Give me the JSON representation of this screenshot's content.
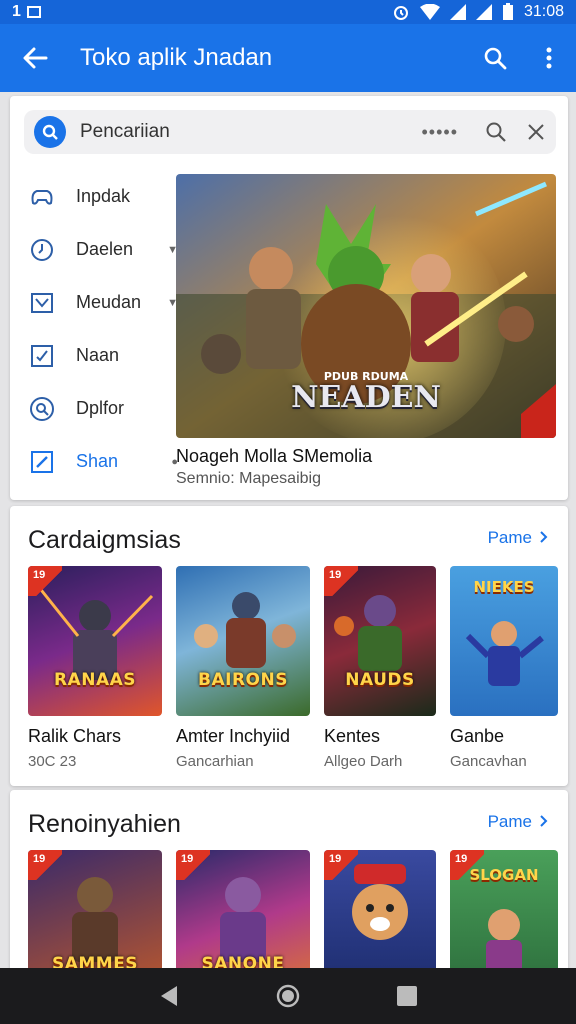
{
  "status": {
    "left": "1",
    "time": "31:08"
  },
  "appbar": {
    "title": "Toko aplik Jnadan"
  },
  "search": {
    "placeholder": "Pencariian",
    "dots": "•••••"
  },
  "nav": [
    {
      "label": "Inpdak",
      "icon": "gamepad-icon",
      "caret": false
    },
    {
      "label": "Daelen",
      "icon": "clock-icon",
      "caret": true
    },
    {
      "label": "Meudan",
      "icon": "chart-icon",
      "caret": true
    },
    {
      "label": "Naan",
      "icon": "check-icon",
      "caret": false
    },
    {
      "label": "Dplfor",
      "icon": "search-circle-icon",
      "caret": false
    },
    {
      "label": "Shan",
      "icon": "edit-icon",
      "caret": false
    }
  ],
  "featured": {
    "art_title": "NEADEN",
    "art_top": "PDUB RDUMA",
    "title": "Noageh Molla SMemolia",
    "subtitle": "Semnio: Mapesaibig"
  },
  "section1": {
    "title": "Cardaigmsias",
    "more": "Pame",
    "tiles": [
      {
        "name": "Ralik Chars",
        "sub": "30C 23",
        "art": "RANAAS",
        "badge": "19"
      },
      {
        "name": "Amter Inchyiid",
        "sub": "Gancarhian",
        "art": "BAIRONS",
        "badge": ""
      },
      {
        "name": "Kentes",
        "sub": "Allgeo Darh",
        "art": "NAUDS",
        "badge": "19"
      },
      {
        "name": "Ganbe",
        "sub": "Gancavhan",
        "art": "NIEKES",
        "badge": ""
      }
    ]
  },
  "section2": {
    "title": "Renoinyahien",
    "more": "Pame",
    "tiles": [
      {
        "art": "SAMMES",
        "badge": "19"
      },
      {
        "art": "SANONE",
        "badge": "19"
      },
      {
        "art": "",
        "badge": "19"
      },
      {
        "art": "SLOGAN",
        "badge": "19"
      }
    ]
  }
}
